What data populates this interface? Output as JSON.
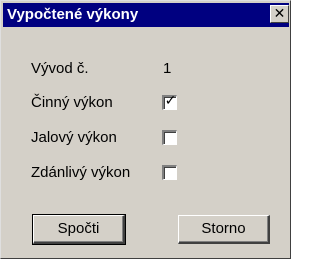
{
  "window": {
    "title": "Vypočtené výkony",
    "close_symbol": "✕",
    "title_bar_color": "#000080",
    "face_color": "#d4d0c8"
  },
  "fields": {
    "vyvod": {
      "label": "Vývod č.",
      "value": "1"
    },
    "cinny": {
      "label": "Činný výkon",
      "checked": true,
      "mark": "✓"
    },
    "jalovy": {
      "label": "Jalový výkon",
      "checked": false,
      "mark": ""
    },
    "zdanlivy": {
      "label": "Zdánlivý výkon",
      "checked": false,
      "mark": ""
    }
  },
  "buttons": {
    "compute": "Spočti",
    "cancel": "Storno"
  }
}
